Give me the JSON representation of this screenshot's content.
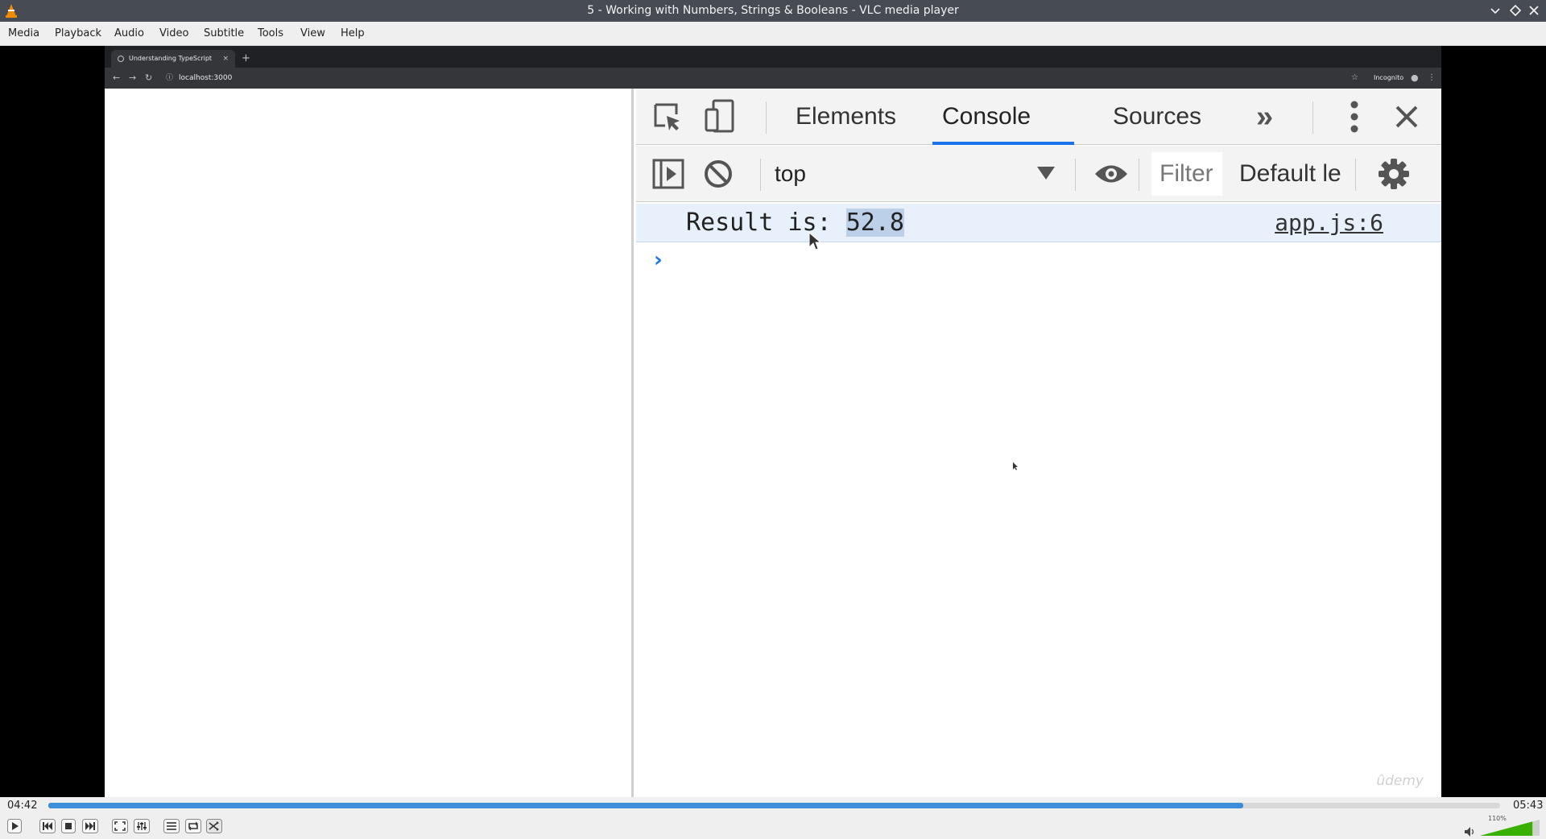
{
  "window": {
    "title": "5 - Working with Numbers, Strings & Booleans - VLC media player"
  },
  "menu": {
    "items": [
      "Media",
      "Playback",
      "Audio",
      "Video",
      "Subtitle",
      "Tools",
      "View",
      "Help"
    ]
  },
  "browser": {
    "tab_title": "Understanding TypeScript",
    "tab_close": "×",
    "new_tab": "+",
    "url": "localhost:3000",
    "profile": "Incognito"
  },
  "devtools": {
    "tabs": [
      "Elements",
      "Console",
      "Sources"
    ],
    "active_tab": "Console",
    "more_tabs": "»",
    "context": "top",
    "filter_placeholder": "Filter",
    "levels": "Default le",
    "console": {
      "message_prefix": "Result is: ",
      "message_value": "52.8",
      "source": "app.js:6",
      "prompt": "›"
    }
  },
  "watermark": "ûdemy",
  "player": {
    "elapsed": "04:42",
    "total": "05:43",
    "progress": 0.823,
    "volume_label": "110%",
    "volume_level": 1.1
  },
  "colors": {
    "accent": "#1a73e8",
    "seek_fill": "#3a8fd8",
    "volume_fill": "#38b000"
  }
}
